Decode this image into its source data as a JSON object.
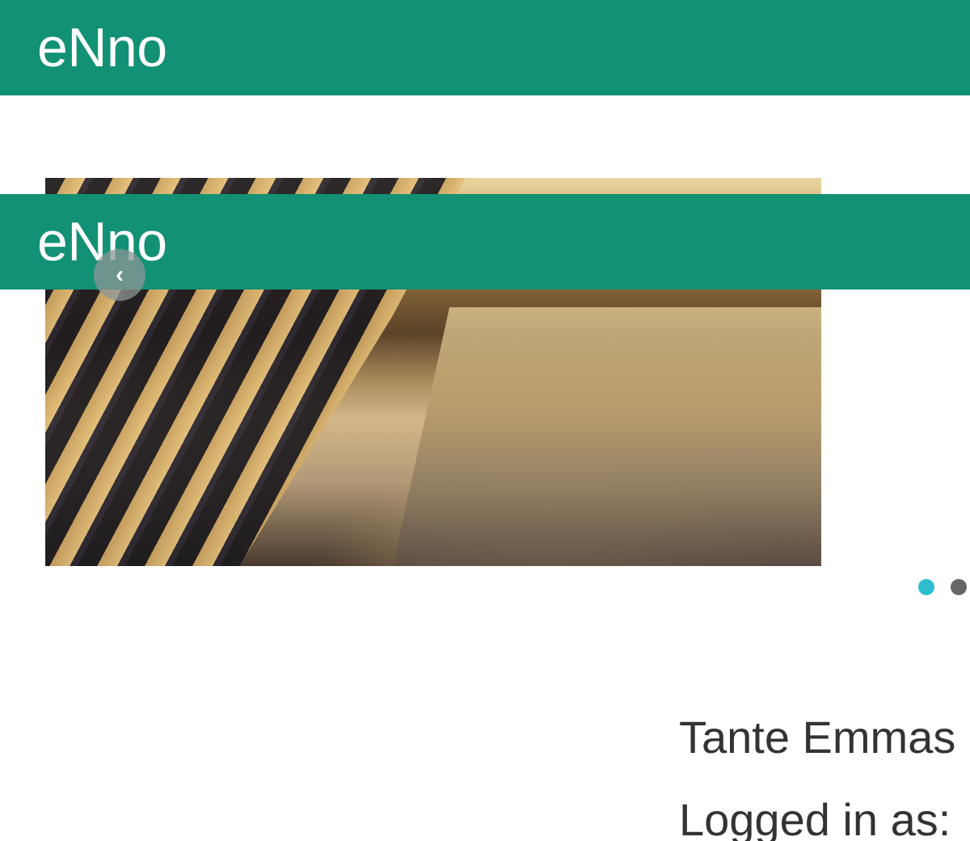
{
  "header": {
    "brand": "eNno"
  },
  "sticky_header": {
    "brand": "eNno"
  },
  "carousel": {
    "prev_icon": "chevron-left-icon",
    "prev_glyph": "‹",
    "slides": [
      {
        "image": "piano-keys-photo",
        "active": true
      },
      {
        "image": "",
        "active": false
      }
    ]
  },
  "store": {
    "name": "Tante Emmas",
    "logged_in_label": "Logged in as:"
  },
  "colors": {
    "brand": "#129175",
    "dot_active": "#2dbfcf",
    "dot_inactive": "#666666",
    "text": "#333333"
  }
}
